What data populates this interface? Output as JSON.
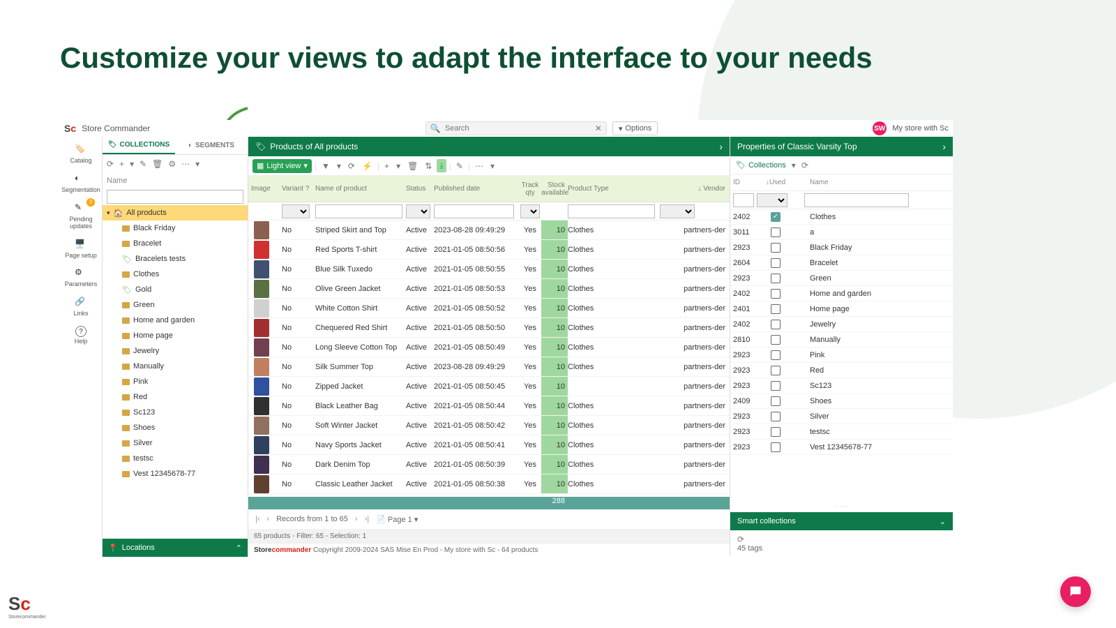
{
  "headline": "Customize your views to adapt the interface to your needs",
  "brand": "Store Commander",
  "search_placeholder": "Search",
  "options_label": "Options",
  "avatar_initials": "SW",
  "store_name": "My store with Sc",
  "left_nav": [
    {
      "label": "Catalog"
    },
    {
      "label": "Segmentation"
    },
    {
      "label": "Pending updates",
      "badge": "3"
    },
    {
      "label": "Page setup"
    },
    {
      "label": "Parameters"
    },
    {
      "label": "Links"
    },
    {
      "label": "Help"
    }
  ],
  "tabs": {
    "collections": "COLLECTIONS",
    "segments": "SEGMENTS"
  },
  "coll_header": "Name",
  "tree_root": "All products",
  "tree_items": [
    {
      "label": "Black Friday",
      "type": "folder"
    },
    {
      "label": "Bracelet",
      "type": "folder"
    },
    {
      "label": "Bracelets tests",
      "type": "tag"
    },
    {
      "label": "Clothes",
      "type": "folder"
    },
    {
      "label": "Gold",
      "type": "tag"
    },
    {
      "label": "Green",
      "type": "folder"
    },
    {
      "label": "Home and garden",
      "type": "folder"
    },
    {
      "label": "Home page",
      "type": "folder"
    },
    {
      "label": "Jewelry",
      "type": "folder"
    },
    {
      "label": "Manually",
      "type": "folder"
    },
    {
      "label": "Pink",
      "type": "folder"
    },
    {
      "label": "Red",
      "type": "folder"
    },
    {
      "label": "Sc123",
      "type": "folder"
    },
    {
      "label": "Shoes",
      "type": "folder"
    },
    {
      "label": "Silver",
      "type": "folder"
    },
    {
      "label": "testsc",
      "type": "folder"
    },
    {
      "label": "Vest 12345678-77",
      "type": "folder"
    }
  ],
  "locations_label": "Locations",
  "products_header": "Products of All products",
  "light_view": "Light view",
  "columns": {
    "image": "Image",
    "variant": "Variant ?",
    "name": "Name of product",
    "status": "Status",
    "date": "Published date",
    "track": "Track qty",
    "stock": "Stock available",
    "type": "Product Type",
    "vendor": "Vendor"
  },
  "products": [
    {
      "variant": "No",
      "name": "Striped Skirt and Top",
      "status": "Active",
      "date": "2023-08-28 09:49:29",
      "track": "Yes",
      "stock": "10",
      "type": "Clothes",
      "vendor": "partners-der"
    },
    {
      "variant": "No",
      "name": "Red Sports T-shirt",
      "status": "Active",
      "date": "2021-01-05 08:50:56",
      "track": "Yes",
      "stock": "10",
      "type": "Clothes",
      "vendor": "partners-der"
    },
    {
      "variant": "No",
      "name": "Blue Silk Tuxedo",
      "status": "Active",
      "date": "2021-01-05 08:50:55",
      "track": "Yes",
      "stock": "10",
      "type": "Clothes",
      "vendor": "partners-der"
    },
    {
      "variant": "No",
      "name": "Olive Green Jacket",
      "status": "Active",
      "date": "2021-01-05 08:50:53",
      "track": "Yes",
      "stock": "10",
      "type": "Clothes",
      "vendor": "partners-der"
    },
    {
      "variant": "No",
      "name": "White Cotton Shirt",
      "status": "Active",
      "date": "2021-01-05 08:50:52",
      "track": "Yes",
      "stock": "10",
      "type": "Clothes",
      "vendor": "partners-der"
    },
    {
      "variant": "No",
      "name": "Chequered Red Shirt",
      "status": "Active",
      "date": "2021-01-05 08:50:50",
      "track": "Yes",
      "stock": "10",
      "type": "Clothes",
      "vendor": "partners-der"
    },
    {
      "variant": "No",
      "name": "Long Sleeve Cotton Top",
      "status": "Active",
      "date": "2021-01-05 08:50:49",
      "track": "Yes",
      "stock": "10",
      "type": "Clothes",
      "vendor": "partners-der"
    },
    {
      "variant": "No",
      "name": "Silk Summer Top",
      "status": "Active",
      "date": "2023-08-28 09:49:29",
      "track": "Yes",
      "stock": "10",
      "type": "Clothes",
      "vendor": "partners-der"
    },
    {
      "variant": "No",
      "name": "Zipped Jacket",
      "status": "Active",
      "date": "2021-01-05 08:50:45",
      "track": "Yes",
      "stock": "10",
      "type": "",
      "vendor": "partners-der"
    },
    {
      "variant": "No",
      "name": "Black Leather Bag",
      "status": "Active",
      "date": "2021-01-05 08:50:44",
      "track": "Yes",
      "stock": "10",
      "type": "Clothes",
      "vendor": "partners-der"
    },
    {
      "variant": "No",
      "name": "Soft Winter Jacket",
      "status": "Active",
      "date": "2021-01-05 08:50:42",
      "track": "Yes",
      "stock": "10",
      "type": "Clothes",
      "vendor": "partners-der"
    },
    {
      "variant": "No",
      "name": "Navy Sports Jacket",
      "status": "Active",
      "date": "2021-01-05 08:50:41",
      "track": "Yes",
      "stock": "10",
      "type": "Clothes",
      "vendor": "partners-der"
    },
    {
      "variant": "No",
      "name": "Dark Denim Top",
      "status": "Active",
      "date": "2021-01-05 08:50:39",
      "track": "Yes",
      "stock": "10",
      "type": "Clothes",
      "vendor": "partners-der"
    },
    {
      "variant": "No",
      "name": "Classic Leather Jacket",
      "status": "Active",
      "date": "2021-01-05 08:50:38",
      "track": "Yes",
      "stock": "10",
      "type": "Clothes",
      "vendor": "partners-der"
    }
  ],
  "totals_stock": "288",
  "pagination_text": "Records from 1 to 65",
  "page_label": "Page 1",
  "status_text": "65 products - Filter: 65 - Selection: 1",
  "footer_brand1": "Store",
  "footer_brand2": "commander",
  "footer_text": "Copyright 2009-2024 SAS Mise En Prod - My store with Sc - 64 products",
  "props_header": "Properties of Classic Varsity Top",
  "props_tab": "Collections",
  "props_cols": {
    "id": "ID",
    "used": "Used",
    "name": "Name"
  },
  "props_rows": [
    {
      "id": "2402",
      "used": true,
      "name": "Clothes"
    },
    {
      "id": "3011",
      "used": false,
      "name": "a"
    },
    {
      "id": "2923",
      "used": false,
      "name": "Black Friday"
    },
    {
      "id": "2604",
      "used": false,
      "name": "Bracelet"
    },
    {
      "id": "2923",
      "used": false,
      "name": "Green"
    },
    {
      "id": "2402",
      "used": false,
      "name": "Home and garden"
    },
    {
      "id": "2401",
      "used": false,
      "name": "Home page"
    },
    {
      "id": "2402",
      "used": false,
      "name": "Jewelry"
    },
    {
      "id": "2810",
      "used": false,
      "name": "Manually"
    },
    {
      "id": "2923",
      "used": false,
      "name": "Pink"
    },
    {
      "id": "2923",
      "used": false,
      "name": "Red"
    },
    {
      "id": "2923",
      "used": false,
      "name": "Sc123"
    },
    {
      "id": "2409",
      "used": false,
      "name": "Shoes"
    },
    {
      "id": "2923",
      "used": false,
      "name": "Silver"
    },
    {
      "id": "2923",
      "used": false,
      "name": "testsc"
    },
    {
      "id": "2923",
      "used": false,
      "name": "Vest 12345678-77"
    }
  ],
  "smart_collections": "Smart collections",
  "tags_count": "45 tags"
}
